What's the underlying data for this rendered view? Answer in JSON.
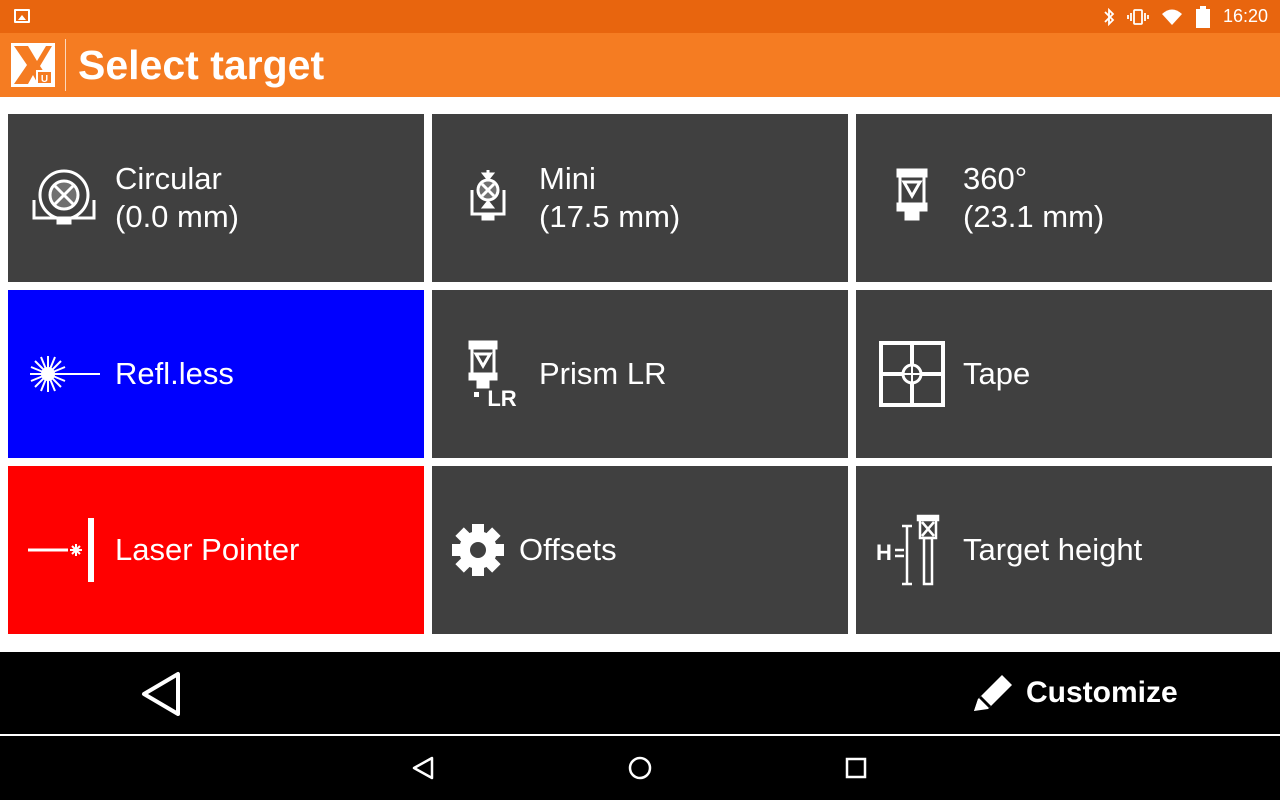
{
  "status_bar": {
    "time": "16:20",
    "icons": [
      "gallery-icon",
      "bluetooth-icon",
      "vibrate-icon",
      "wifi-icon",
      "battery-icon"
    ]
  },
  "app_bar": {
    "title": "Select target",
    "logo": "app-logo-icon"
  },
  "targets": [
    {
      "line1": "Circular",
      "line2": "(0.0 mm)",
      "icon": "circular-prism-icon",
      "color": "#404040"
    },
    {
      "line1": "Mini",
      "line2": "(17.5 mm)",
      "icon": "mini-prism-icon",
      "color": "#404040"
    },
    {
      "line1": "360°",
      "line2": "(23.1 mm)",
      "icon": "360-prism-icon",
      "color": "#404040"
    },
    {
      "line1": "Refl.less",
      "icon": "reflectorless-icon",
      "color": "#0000ff"
    },
    {
      "line1": "Prism LR",
      "icon": "prism-lr-icon",
      "color": "#404040"
    },
    {
      "line1": "Tape",
      "icon": "tape-target-icon",
      "color": "#404040"
    },
    {
      "line1": "Laser Pointer",
      "icon": "laser-pointer-icon",
      "color": "#ff0000"
    },
    {
      "line1": "Offsets",
      "icon": "gear-icon",
      "color": "#404040"
    },
    {
      "line1": "Target height",
      "icon": "target-height-icon",
      "color": "#404040"
    }
  ],
  "action_bar": {
    "back_icon": "back-triangle-icon",
    "customize_label": "Customize",
    "customize_icon": "pencil-icon"
  },
  "nav_bar": {
    "buttons": [
      "nav-back-icon",
      "nav-home-icon",
      "nav-recents-icon"
    ]
  },
  "colors": {
    "status_bar": "#e8650e",
    "app_bar": "#f57c22",
    "tile_default": "#404040",
    "tile_reflectorless": "#0000ff",
    "tile_laser": "#ff0000"
  }
}
